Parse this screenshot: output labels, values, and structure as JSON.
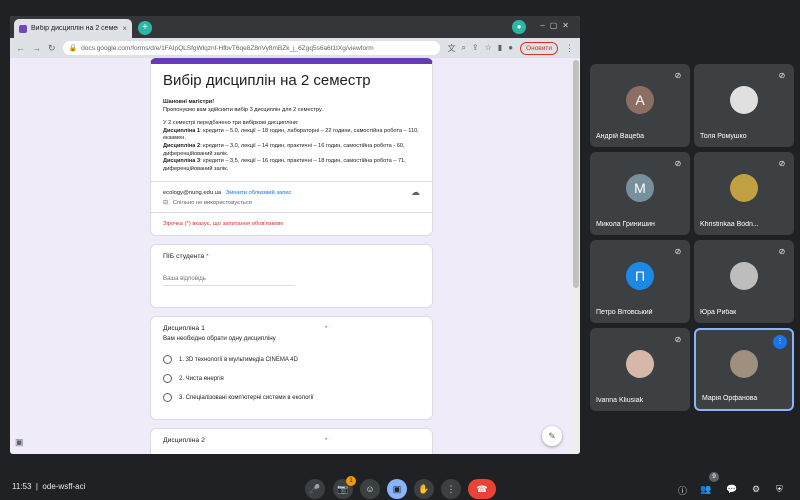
{
  "browser": {
    "tab_title": "Вибір дисциплін на 2 семестр",
    "tab_close": "×",
    "new_tab": "+",
    "url": "docs.google.com/forms/d/e/1FAIpQLSfgWlqznf-HfbvT6qe8Z8nVy8mBZk_j_6Zgq5s6a6t1tXg/viewform",
    "renew_label": "Оновити"
  },
  "form": {
    "title": "Вибір дисциплін на 2 семестр",
    "greeting": "Шановні магістри!",
    "intro": "Пропонуємо вам здійснити вибір 3 дисциплін для 2 семестру.",
    "semester_note": "У 2 семестрі передбачено три вибіркові дисципліни:",
    "disc1_label": "Дисципліна 1",
    "disc1_text": ": кредити – 5,0, лекції – 18 годин, лабораторні – 22 години, самостійна робота – 110, екзамен.",
    "disc2_label": "Дисципліна 2",
    "disc2_text": ": кредити – 3,0, лекції – 14 годин, практичні – 16 годин, самостійна робота - 60, диференційований залік.",
    "disc3_label": "Дисципліна 3",
    "disc3_text": ": кредити – 3,5, лекції – 16 годин, практичні – 18 годин, самостійна робота – 71, диференційований залік.",
    "account_email": "ecology@nung.edu.ua",
    "switch_account": "Змінити обліковий запис",
    "not_shared": "Спільно не використовується",
    "required_note": "Зірочка (*) вказує, що запитання обов'язкове",
    "q1_title": "ПІБ студента",
    "q1_placeholder": "Ваша відповідь",
    "q2_title": "Дисципліна 1",
    "q2_subtitle": "Вам необхідно обрати одну дисципліну",
    "q2_options": [
      "1. 3D технології в мультимедіа CINEMA 4D",
      "2. Чиста енергія",
      "3. Спеціалізовані комп'ютерні системи в екології"
    ],
    "q3_title": "Дисципліна 2",
    "required_star": "*"
  },
  "participants": [
    {
      "name": "Андрій Вацеба",
      "initial": "A",
      "color": "#8d6e63"
    },
    {
      "name": "Толя Ромушко",
      "initial": "",
      "color": "#e0e0e0"
    },
    {
      "name": "Микола Гринишин",
      "initial": "M",
      "color": "#78909c"
    },
    {
      "name": "Khristinkaa Bodn...",
      "initial": "",
      "color": "#c0a040"
    },
    {
      "name": "Петро Вітовський",
      "initial": "П",
      "color": "#1e88e5"
    },
    {
      "name": "Юра Рибак",
      "initial": "",
      "color": "#bdbdbd"
    },
    {
      "name": "Ivanna Kliusiak",
      "initial": "",
      "color": "#d7b8a8"
    },
    {
      "name": "Марія Орфанова",
      "initial": "",
      "color": "#9e8f7e"
    }
  ],
  "meeting": {
    "time": "11:53",
    "code": "ode-wsff-aci",
    "separator": "|",
    "notification_count": "1",
    "people_count": "9"
  },
  "icons": {
    "mic": "🎤",
    "camera": "📷",
    "emoji": "☺",
    "present": "▣",
    "hand": "✋",
    "more": "⋮",
    "leave": "☎",
    "info": "ⓘ",
    "people": "👥",
    "chat": "💬",
    "activities": "⚙",
    "lock": "🔒"
  }
}
